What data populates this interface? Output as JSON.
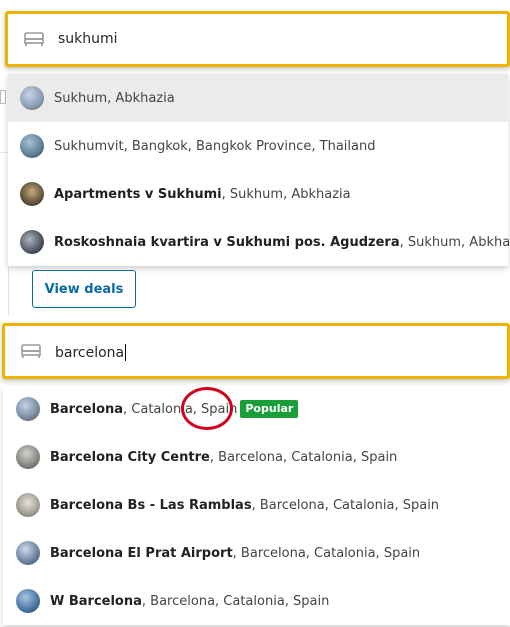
{
  "search1": {
    "value": "sukhumi",
    "suggestions": [
      {
        "bold": "",
        "rest": "Sukhum, Abkhazia",
        "thumb": "#8a9bb5"
      },
      {
        "bold": "",
        "rest": "Sukhumvit, Bangkok, Bangkok Province, Thailand",
        "thumb": "#5e7f95"
      },
      {
        "bold": "Apartments v Sukhumi",
        "rest": ", Sukhum, Abkhazia",
        "thumb": "#6b5a44"
      },
      {
        "bold": "Roskoshnaia kvartira v Sukhumi pos. Agudzera",
        "rest": ", Sukhum, Abkhazia",
        "thumb": "#4d5560"
      }
    ]
  },
  "view_deals_label": "View deals",
  "search2": {
    "value": "barcelona",
    "suggestions": [
      {
        "bold": "Barcelona",
        "rest": ", Catalonia, Spain",
        "thumb": "#7d90a8",
        "badge": "Popular"
      },
      {
        "bold": "Barcelona City Centre",
        "rest": ", Barcelona, Catalonia, Spain",
        "thumb": "#8b8b86"
      },
      {
        "bold": "Barcelona Bs - Las Ramblas",
        "rest": ", Barcelona, Catalonia, Spain",
        "thumb": "#a8a49c"
      },
      {
        "bold": "Barcelona El Prat Airport",
        "rest": ", Barcelona, Catalonia, Spain",
        "thumb": "#6f86a3"
      },
      {
        "bold": "W Barcelona",
        "rest": ", Barcelona, Catalonia, Spain",
        "thumb": "#4e79a8"
      }
    ]
  },
  "colors": {
    "accent_border": "#f0b400",
    "link_blue": "#0a6aa8",
    "badge_green": "#1a9e3a",
    "highlight_red": "#d0021b"
  }
}
